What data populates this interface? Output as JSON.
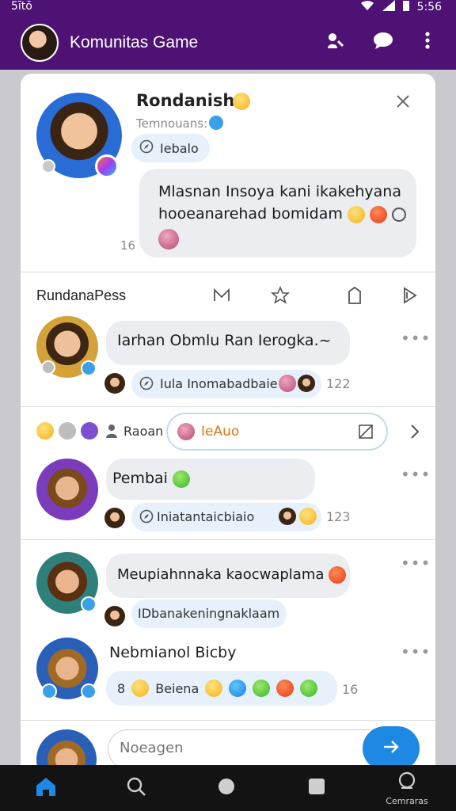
{
  "status_bar": {
    "left": "5ītō",
    "time": "5:56"
  },
  "app_bar": {
    "title": "Komunitas Game"
  },
  "post": {
    "name": "Rondanisha",
    "subtitle": "Temnouans:",
    "tag": "Iebalo",
    "message_line1": "Mlasnan Insoya kani ikakehyana",
    "message_line2": "hooeanarehad bomidam",
    "count": "16"
  },
  "section": {
    "title": "RundanaPess",
    "tab_icons": [
      "mail-icon",
      "star-icon",
      "bookmark-icon",
      "share-icon"
    ]
  },
  "comments": [
    {
      "text": "Iarhan Obmlu Ran Ierogka.~",
      "reply": "Iula Inomabadbaie",
      "count": "122"
    },
    {
      "react_label": "Raoan",
      "react_chip": "IeAuo",
      "text": "Pembai",
      "reply": "Iniatantaicbiaio",
      "count": "123"
    },
    {
      "text": "Meupiahnnaka kaocwaplama",
      "reply": "IDbanakeningnaklaam"
    },
    {
      "name": "Nebmianol Bicby",
      "reaction_word": "Beiena",
      "count": "16"
    }
  ],
  "composer": {
    "placeholder": "Noeagen"
  },
  "bottom_nav": {
    "items": [
      {
        "icon": "home-icon"
      },
      {
        "icon": "search-icon"
      },
      {
        "icon": "circle-icon"
      },
      {
        "icon": "square-icon"
      },
      {
        "icon": "camera-icon",
        "label": "Cemraras"
      }
    ]
  }
}
